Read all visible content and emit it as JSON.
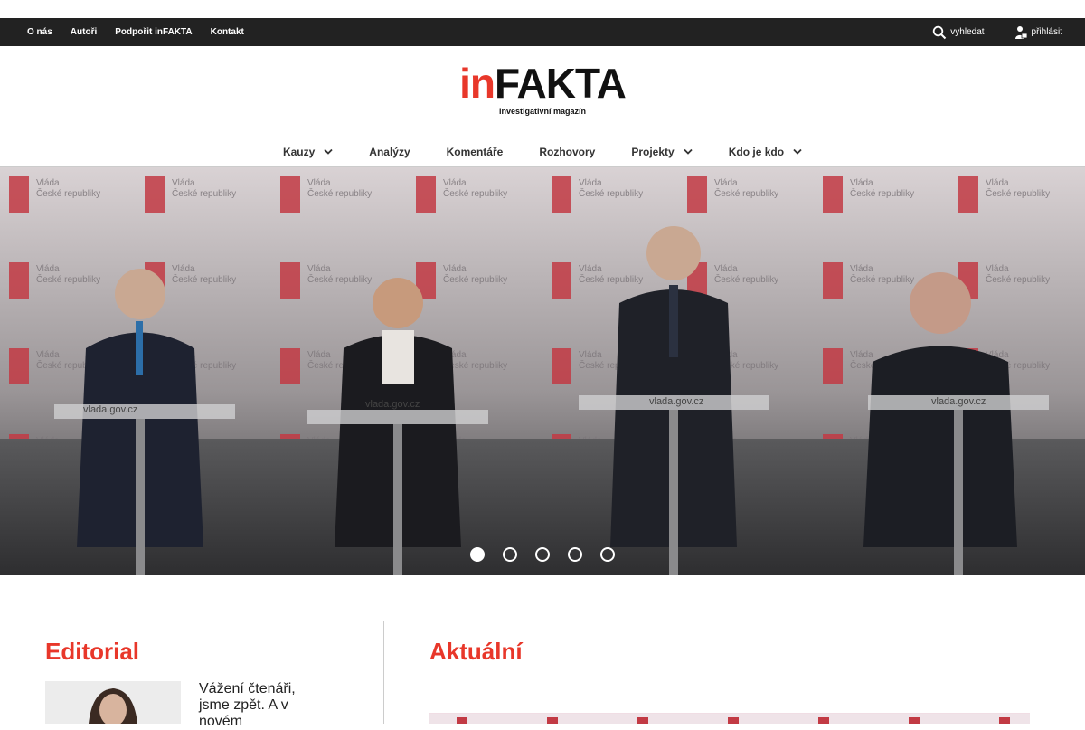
{
  "top_nav": {
    "items": [
      "O nás",
      "Autoři",
      "Podpořit inFAKTA",
      "Kontakt"
    ]
  },
  "top_actions": {
    "search": "vyhledat",
    "login": "přihlásit",
    "search_icon": "search-icon",
    "login_icon": "user-lock-icon"
  },
  "logo": {
    "in": "in",
    "fakta": "FAKTA",
    "tagline": "investigativní magazín"
  },
  "main_nav": {
    "items": [
      {
        "label": "Kauzy",
        "dropdown": true
      },
      {
        "label": "Analýzy",
        "dropdown": false
      },
      {
        "label": "Komentáře",
        "dropdown": false
      },
      {
        "label": "Rozhovory",
        "dropdown": false
      },
      {
        "label": "Projekty",
        "dropdown": true
      },
      {
        "label": "Kdo je kdo",
        "dropdown": true
      }
    ]
  },
  "hero": {
    "backdrop_text": "Vláda České republiky",
    "podium_text": "vlada.gov.cz",
    "slides_total": 5,
    "active_slide": 1
  },
  "editorial": {
    "title": "Editorial",
    "text": "Vážení čtenáři, jsme zpět. A v novém"
  },
  "aktualni": {
    "title": "Aktuální"
  },
  "colors": {
    "accent": "#e8372a",
    "topbar": "#222222"
  }
}
